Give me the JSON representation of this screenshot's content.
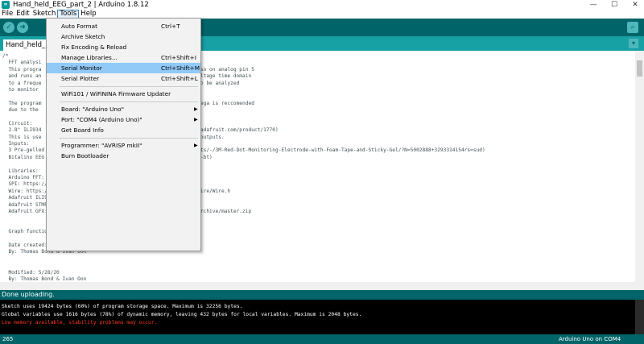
{
  "window": {
    "title": "Hand_held_EEG_part_2 | Arduino 1.8.12",
    "icon": "arduino-icon",
    "minimize": "—",
    "maximize": "☐",
    "close": "✕"
  },
  "menu": {
    "file": "File",
    "edit": "Edit",
    "sketch": "Sketch",
    "tools": "Tools",
    "help": "Help"
  },
  "toolbar": {
    "verify": "✓",
    "upload": "➜",
    "serial": "⌕"
  },
  "tab": {
    "name": "Hand_held_EEG_part_2",
    "menu": "▾"
  },
  "code_lines": [
    "/*",
    "  FFT analysi",
    "  This progra                                                    nso on analog pin 5",
    "  and runs an                                                    oltage time domain",
    "  to a freque                                                    to be analyzed",
    "  to monitor",
    "",
    "  The program                                                    mega is reccomended",
    "  due to the",
    "",
    "  Circuit:",
    "  2.8\" ILI934                                                   w.adafruit.com/product/1770)",
    "  This is use                                                     outputs.",
    "  Inputs:",
    "  3 Pre-gelled electrode (https://www.mouser.com/ols/all-3m-products/-/3M-Red-Dot-Monitoring-Electrode-with-Foam-Tape-and-Sticky-Gel/?N=5002888+3293314154rs=sud)",
    "  Bitalino EEG microprocessor (https://bitalino.com/en/plugged-kit-bt)",
    "",
    "  Libraries:",
    "  Arduino FFT: https://github.com/kosme/arduinoFFT",
    "  SPI: https://github.com/PaulStoffregen/SPI",
    "  Wire: https://github.com/esp8266/Arduino/blob/master/libraries/Wire/Wire.h",
    "  Adafruit ILI9341: https://github.com/adafruit/Adafruit_ILI9341",
    "  Adafruit STMPE610: https://github.com/adafruit/Adafruit_STMPE610",
    "  Adafruit GFX: https://github.com/adafruit/Adafruit-GFX-Library/archive/master.zip",
    "",
    "",
    "  Graph function: https://github.com/KrisKasprzak/GraphingFunction",
    "",
    "  Date created: 4/24/20",
    "  By: Thomas Bond & Ivan Oon",
    "",
    "",
    "  Modified: 5/28/20",
    "  By: Thomas Bond & Ivan Oon"
  ],
  "status": "Done uploading.",
  "console": [
    "Sketch uses 19424 bytes (60%) of program storage space. Maximum is 32256 bytes.",
    "Global variables use 1616 bytes (78%) of dynamic memory, leaving 432 bytes for local variables. Maximum is 2048 bytes.",
    "Low memory available, stability problems may occur."
  ],
  "footer": {
    "line": "265",
    "board": "Arduino Uno on COM4"
  },
  "tools_menu": [
    {
      "label": "Auto Format",
      "shortcut": "Ctrl+T"
    },
    {
      "label": "Archive Sketch",
      "shortcut": ""
    },
    {
      "label": "Fix Encoding & Reload",
      "shortcut": ""
    },
    {
      "label": "Manage Libraries...",
      "shortcut": "Ctrl+Shift+I"
    },
    {
      "label": "Serial Monitor",
      "shortcut": "Ctrl+Shift+M"
    },
    {
      "label": "Serial Plotter",
      "shortcut": "Ctrl+Shift+L"
    },
    {
      "label": "WiFi101 / WiFiNINA Firmware Updater",
      "shortcut": ""
    },
    {
      "label": "Board: \"Arduino Uno\"",
      "shortcut": ""
    },
    {
      "label": "Port: \"COM4 (Arduino Uno)\"",
      "shortcut": ""
    },
    {
      "label": "Get Board Info",
      "shortcut": ""
    },
    {
      "label": "Programmer: \"AVRISP mkII\"",
      "shortcut": ""
    },
    {
      "label": "Burn Bootloader",
      "shortcut": ""
    }
  ],
  "submenu_arrow": "▶",
  "colors": {
    "toolbar": "#006468",
    "tabbar": "#17a1a5",
    "highlight": "#91c9f7",
    "warning": "#ff3a1f"
  }
}
